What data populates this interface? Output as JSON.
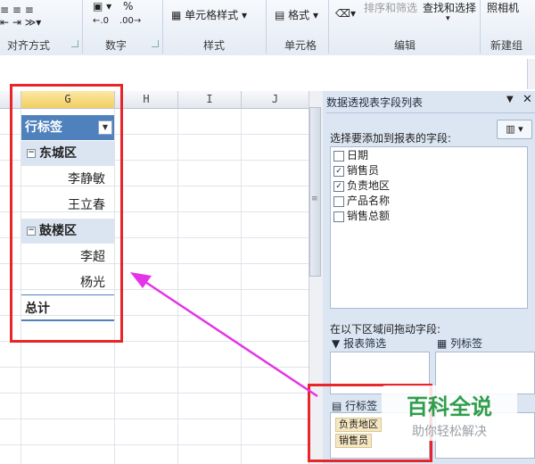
{
  "ribbon": {
    "groups": [
      "对齐方式",
      "数字",
      "样式",
      "单元格",
      "编辑",
      "新建组"
    ],
    "cell_styles": "单元格样式",
    "format": "格式",
    "sort_filter": "排序和筛选",
    "find_select": "查找和选择",
    "camera": "照相机",
    "number_percent": "%",
    "decimal_inc": ".00",
    "decimal_dec": ".0"
  },
  "sheet": {
    "columns": [
      "G",
      "H",
      "I",
      "J"
    ],
    "pivot": {
      "header": "行标签",
      "groups": [
        {
          "name": "东城区",
          "items": [
            "李静敏",
            "王立春"
          ]
        },
        {
          "name": "鼓楼区",
          "items": [
            "李超",
            "杨光"
          ]
        }
      ],
      "total": "总计"
    }
  },
  "panel": {
    "title": "数据透视表字段列表",
    "choose_label": "选择要添加到报表的字段:",
    "fields": [
      {
        "name": "日期",
        "checked": false
      },
      {
        "name": "销售员",
        "checked": true
      },
      {
        "name": "负责地区",
        "checked": true
      },
      {
        "name": "产品名称",
        "checked": false
      },
      {
        "name": "销售总额",
        "checked": false
      }
    ],
    "drag_label": "在以下区域间拖动字段:",
    "report_filter": "报表筛选",
    "column_labels": "列标签",
    "row_labels": "行标签",
    "row_fields": [
      "负责地区",
      "销售员"
    ]
  },
  "watermark": {
    "title": "百科全说",
    "subtitle": "助你轻松解决"
  },
  "colors": {
    "highlight": "#e8252a",
    "arrow": "#e334e6",
    "pivot_header": "#4f81bd"
  }
}
